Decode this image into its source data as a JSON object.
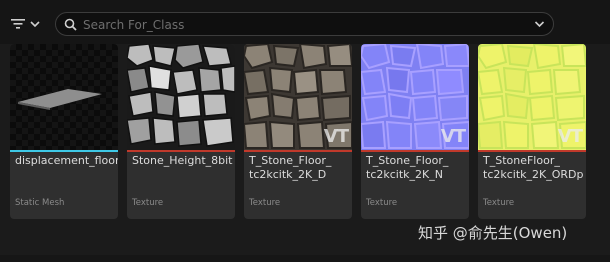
{
  "search": {
    "placeholder": "Search For_Class",
    "value": ""
  },
  "colors": {
    "static_mesh_bar": "#3ec8e6",
    "texture_bar": "#c0392b",
    "tile_bg": "#2f2f2f"
  },
  "assets": [
    {
      "name": "displacement_floor",
      "type": "Static Mesh",
      "vt": false,
      "bar_color": "#3ec8e6"
    },
    {
      "name": "Stone_Height_8bit",
      "type": "Texture",
      "vt": false,
      "bar_color": "#c0392b"
    },
    {
      "name": "T_Stone_Floor_\ntc2kcitk_2K_D",
      "type": "Texture",
      "vt": true,
      "vt_label": "VT",
      "bar_color": "#c0392b"
    },
    {
      "name": "T_Stone_Floor_\ntc2kcitk_2K_N",
      "type": "Texture",
      "vt": true,
      "vt_label": "VT",
      "bar_color": "#c0392b"
    },
    {
      "name": "T_StoneFloor_\ntc2kcitk_2K_ORDp",
      "type": "Texture",
      "vt": true,
      "vt_label": "VT",
      "bar_color": "#c0392b"
    }
  ],
  "watermark": "知乎 @俞先生(Owen)"
}
